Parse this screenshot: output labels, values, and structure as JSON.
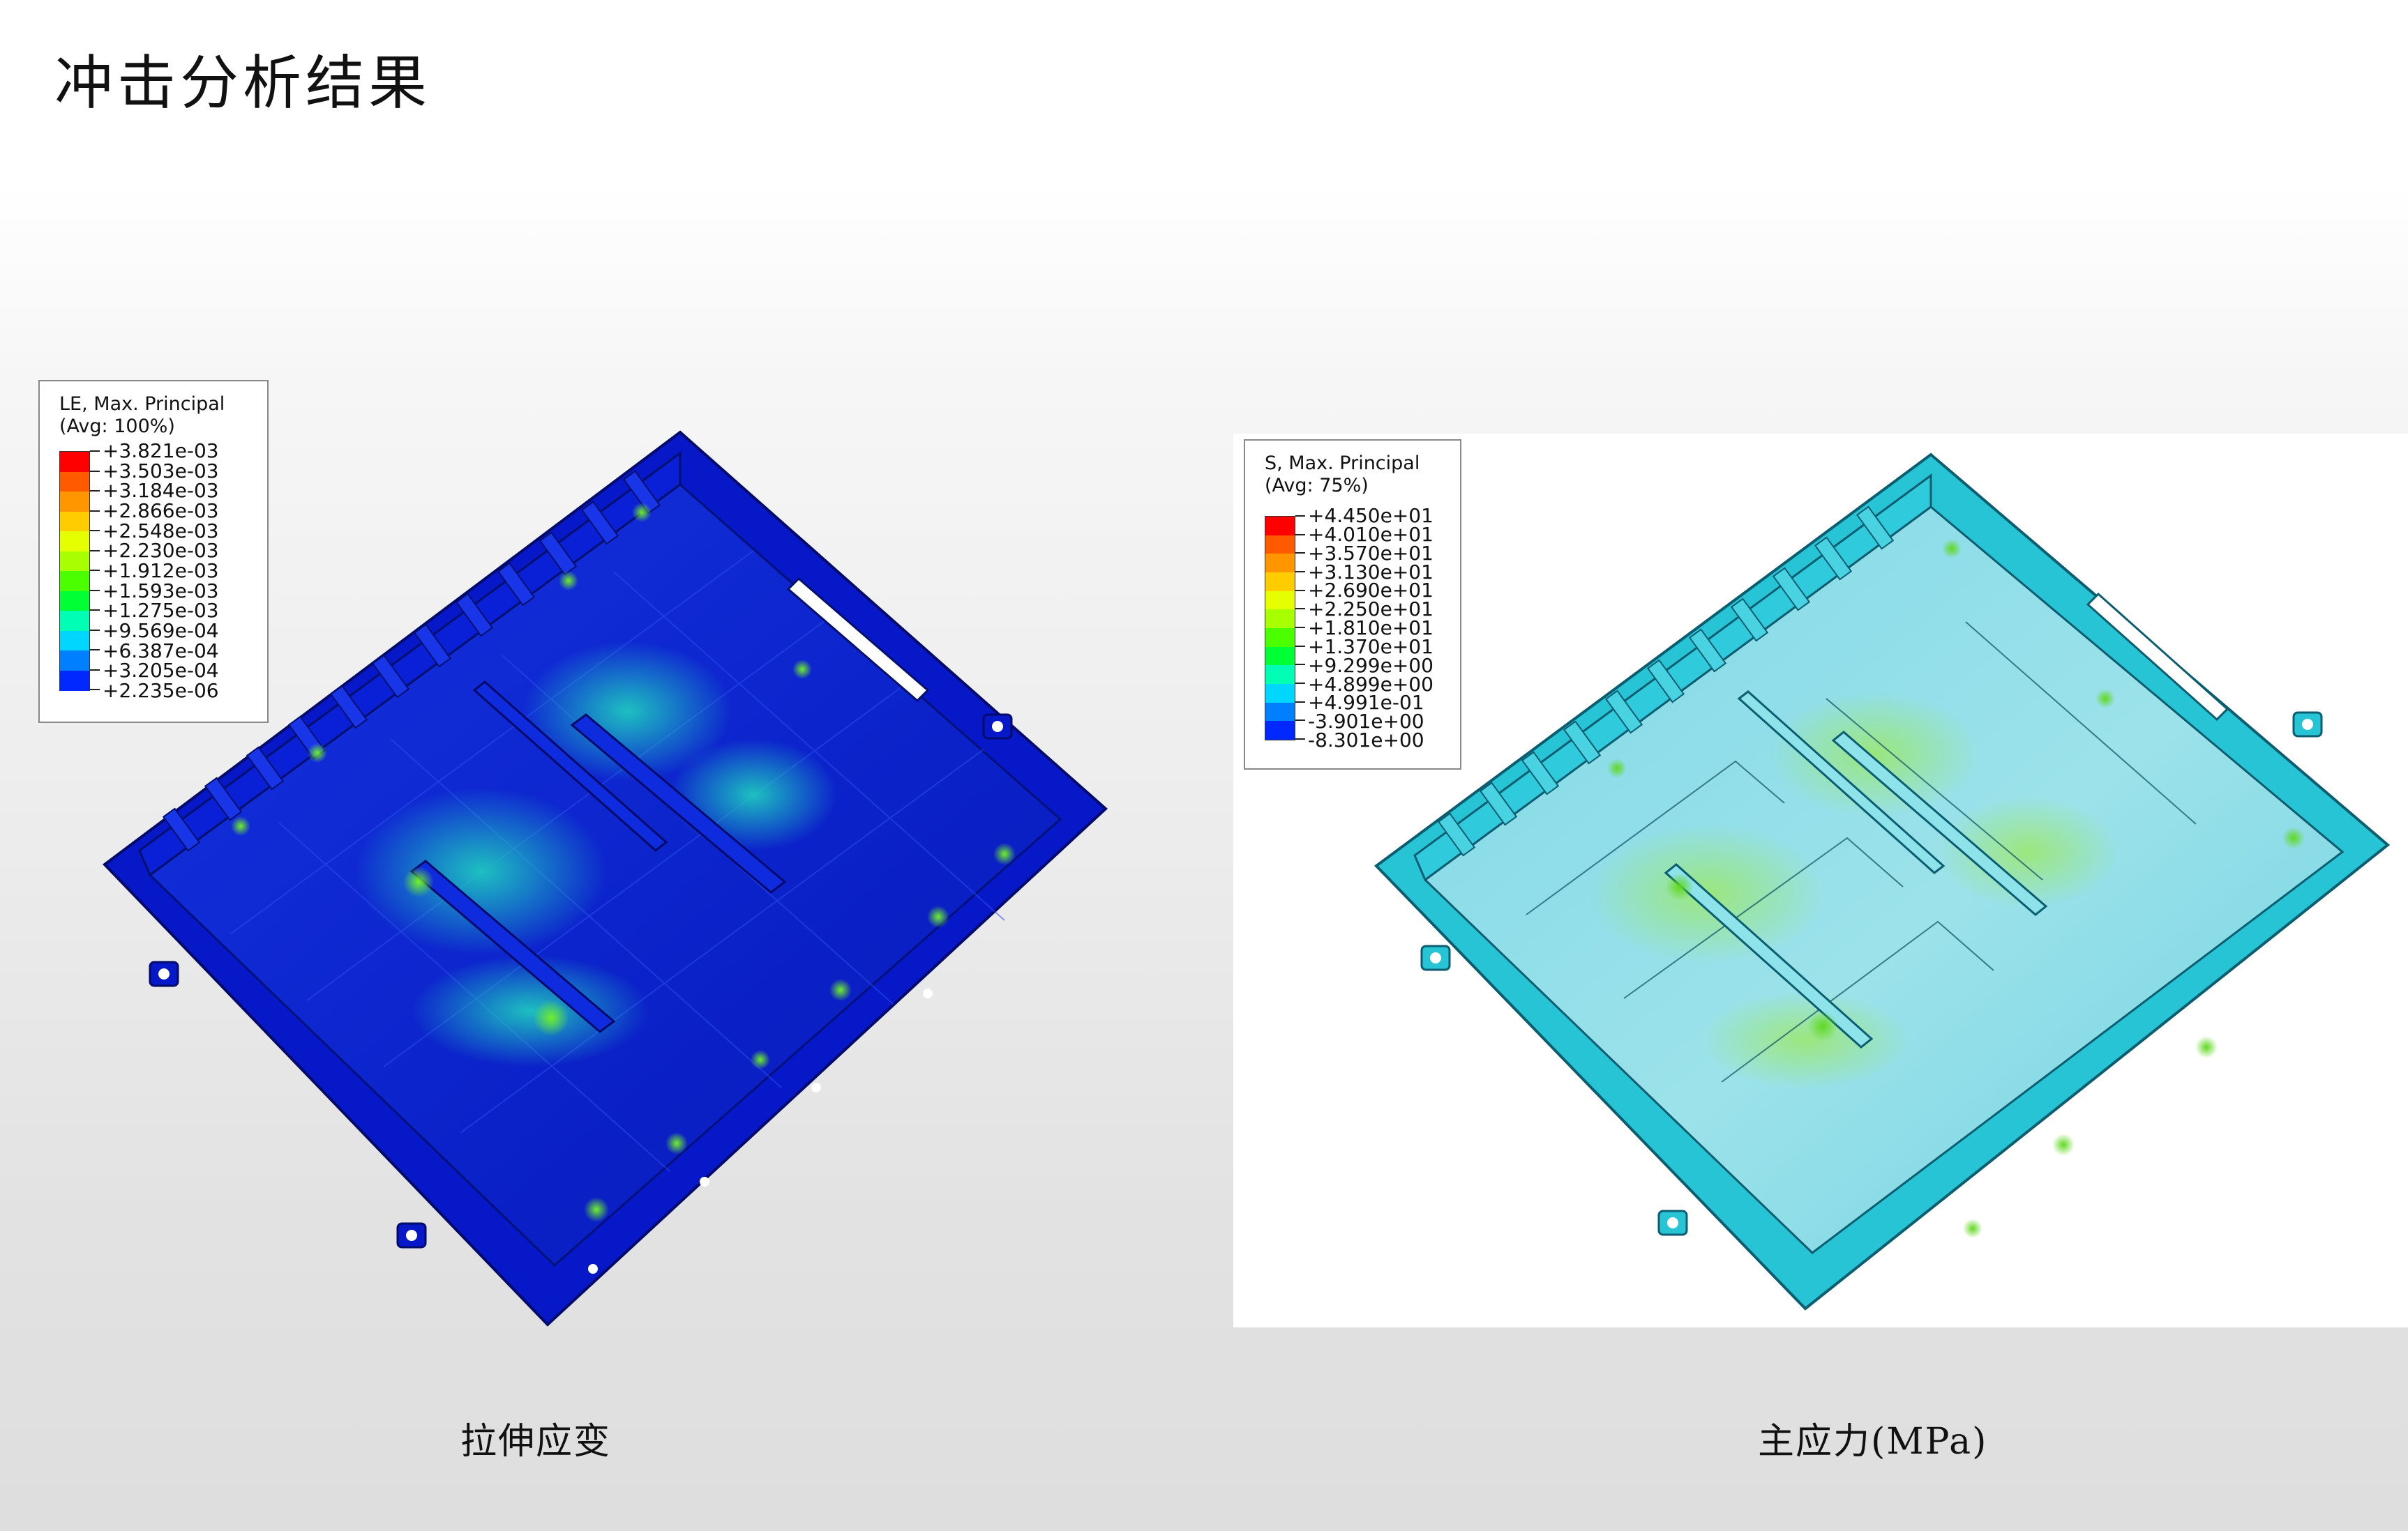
{
  "title": "冲击分析结果",
  "left_panel": {
    "caption": "拉伸应变",
    "legend": {
      "title_line1": "LE, Max. Principal",
      "title_line2": "(Avg: 100%)",
      "values": [
        "+3.821e-03",
        "+3.503e-03",
        "+3.184e-03",
        "+2.866e-03",
        "+2.548e-03",
        "+2.230e-03",
        "+1.912e-03",
        "+1.593e-03",
        "+1.275e-03",
        "+9.569e-04",
        "+6.387e-04",
        "+3.205e-04",
        "+2.235e-06"
      ],
      "colors": [
        "#ff0000",
        "#ff5a00",
        "#ff9600",
        "#ffcc00",
        "#e6ff00",
        "#a8ff00",
        "#4cff00",
        "#00ff34",
        "#00ffb4",
        "#00d6ff",
        "#0080ff",
        "#0028ff"
      ]
    },
    "model_colors": {
      "base": "#0a1fd0",
      "highlight": "#15b6c8",
      "hotspot": "#59e01f"
    }
  },
  "right_panel": {
    "caption": "主应力(MPa)",
    "legend": {
      "title_line1": "S, Max. Principal",
      "title_line2": "(Avg: 75%)",
      "values": [
        "+4.450e+01",
        "+4.010e+01",
        "+3.570e+01",
        "+3.130e+01",
        "+2.690e+01",
        "+2.250e+01",
        "+1.810e+01",
        "+1.370e+01",
        "+9.299e+00",
        "+4.899e+00",
        "+4.991e-01",
        "-3.901e+00",
        "-8.301e+00"
      ],
      "colors": [
        "#ff0000",
        "#ff5a00",
        "#ff9600",
        "#ffcc00",
        "#e6ff00",
        "#a8ff00",
        "#4cff00",
        "#00ff34",
        "#00ffb4",
        "#00d6ff",
        "#0080ff",
        "#0028ff"
      ]
    },
    "model_colors": {
      "base": "#1ec8d8",
      "highlight": "#8ce0ea",
      "hotspot": "#7ade2a"
    }
  }
}
